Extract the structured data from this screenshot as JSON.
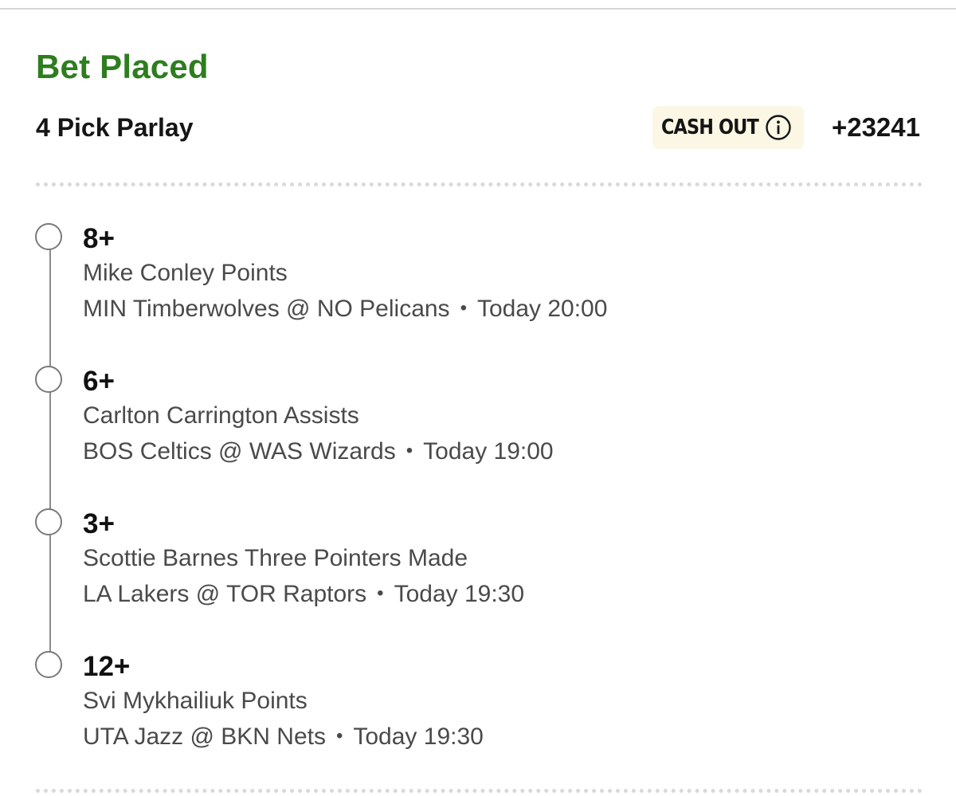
{
  "header": {
    "status_title": "Bet Placed",
    "bet_type": "4 Pick Parlay",
    "cash_out_label": "CASH OUT",
    "odds": "+23241"
  },
  "colors": {
    "status_green": "#2e7d1f",
    "cash_out_bg": "#fbf7e4",
    "timeline_gray": "#7a7a7a"
  },
  "icons": {
    "cash_out_info": "info-icon",
    "leg_marker": "open-circle"
  },
  "legs": [
    {
      "line": "8+",
      "market": "Mike Conley Points",
      "matchup": "MIN Timberwolves @ NO Pelicans",
      "time": "Today 20:00"
    },
    {
      "line": "6+",
      "market": "Carlton Carrington Assists",
      "matchup": "BOS Celtics @ WAS Wizards",
      "time": "Today 19:00"
    },
    {
      "line": "3+",
      "market": "Scottie Barnes Three Pointers Made",
      "matchup": "LA Lakers @ TOR Raptors",
      "time": "Today 19:30"
    },
    {
      "line": "12+",
      "market": "Svi Mykhailiuk Points",
      "matchup": "UTA Jazz @ BKN Nets",
      "time": "Today 19:30"
    }
  ],
  "separator": "•"
}
